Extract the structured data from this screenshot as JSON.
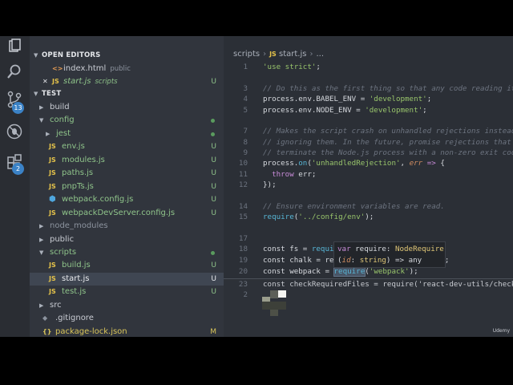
{
  "sidebar": {
    "open_editors_header": "OPEN EDITORS",
    "open_editors": [
      {
        "name": "index.html",
        "desc": "public",
        "icon": "html-icon",
        "active": false
      },
      {
        "name": "start.js",
        "desc": "scripts",
        "icon": "js-icon",
        "status": "U",
        "active": true
      }
    ],
    "project_header": "TEST",
    "tree": [
      {
        "name": "build",
        "kind": "folder",
        "open": false,
        "depth": 0,
        "status": ""
      },
      {
        "name": "config",
        "kind": "folder",
        "open": true,
        "depth": 0,
        "status": "dot"
      },
      {
        "name": "jest",
        "kind": "folder",
        "open": false,
        "depth": 1,
        "status": "dot"
      },
      {
        "name": "env.js",
        "kind": "js",
        "depth": 1,
        "status": "U"
      },
      {
        "name": "modules.js",
        "kind": "js",
        "depth": 1,
        "status": "U"
      },
      {
        "name": "paths.js",
        "kind": "js",
        "depth": 1,
        "status": "U"
      },
      {
        "name": "pnpTs.js",
        "kind": "js",
        "depth": 1,
        "status": "U"
      },
      {
        "name": "webpack.config.js",
        "kind": "webpack",
        "depth": 1,
        "status": "U"
      },
      {
        "name": "webpackDevServer.config.js",
        "kind": "js",
        "depth": 1,
        "status": "U"
      },
      {
        "name": "node_modules",
        "kind": "folder",
        "open": false,
        "depth": 0,
        "status": "",
        "muted": true
      },
      {
        "name": "public",
        "kind": "folder",
        "open": false,
        "depth": 0,
        "status": ""
      },
      {
        "name": "scripts",
        "kind": "folder",
        "open": true,
        "depth": 0,
        "status": "dot"
      },
      {
        "name": "build.js",
        "kind": "js",
        "depth": 1,
        "status": "U"
      },
      {
        "name": "start.js",
        "kind": "js",
        "depth": 1,
        "status": "U",
        "selected": true
      },
      {
        "name": "test.js",
        "kind": "js",
        "depth": 1,
        "status": "U"
      },
      {
        "name": "src",
        "kind": "folder",
        "open": false,
        "depth": 0,
        "status": ""
      },
      {
        "name": ".gitignore",
        "kind": "git",
        "depth": 0,
        "status": ""
      },
      {
        "name": "package-lock.json",
        "kind": "json",
        "depth": 0,
        "status": "M"
      }
    ]
  },
  "activity": {
    "scm_badge": "13",
    "extensions_badge": "2"
  },
  "breadcrumb": {
    "folder": "scripts",
    "file": "start.js",
    "rest": "..."
  },
  "tooltip": {
    "line1_kw": "var",
    "line1_id": " require",
    "line1_colon": ": ",
    "line1_type": "NodeRequire",
    "line2_open": "(",
    "line2_param": "id",
    "line2_colon": ": ",
    "line2_type": "string",
    "line2_rest": ") => any"
  },
  "peek_partial": "const checkRequiredFiles = require('react-dev-utils/checkR",
  "peek_line_num": "2",
  "watermark": "Udemy"
}
